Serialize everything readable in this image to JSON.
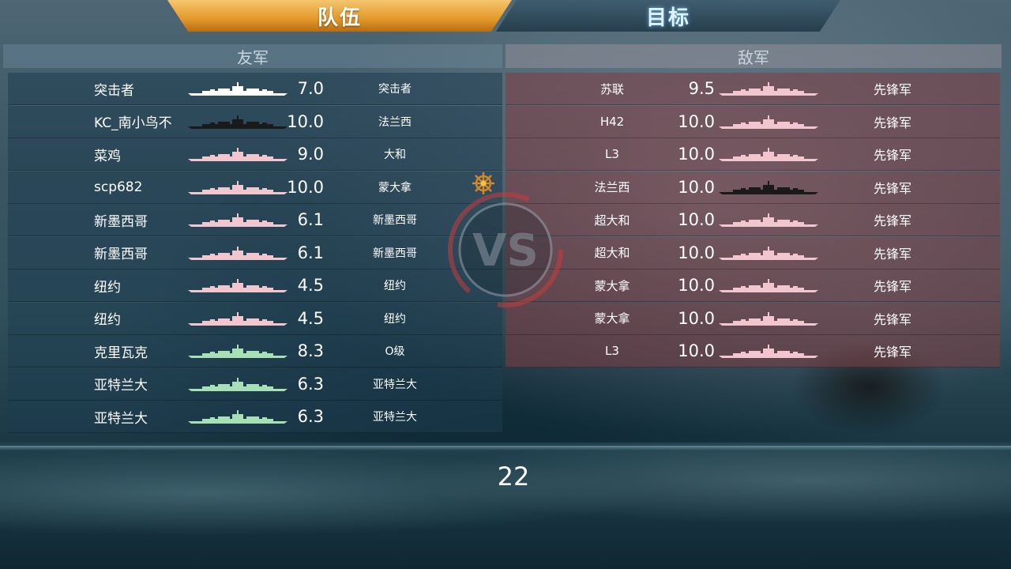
{
  "tabs": {
    "team": "队伍",
    "target": "目标"
  },
  "allies": {
    "header": "友军",
    "rows": [
      {
        "name": "突击者",
        "level": "7.0",
        "ship_class": "突击者",
        "ship_color": "#ffffff"
      },
      {
        "name": "KC_南小鸟不",
        "level": "10.0",
        "ship_class": "法兰西",
        "ship_color": "#1a1a1a"
      },
      {
        "name": "菜鸡",
        "level": "9.0",
        "ship_class": "大和",
        "ship_color": "#f2c6cf"
      },
      {
        "name": "scp682",
        "level": "10.0",
        "ship_class": "蒙大拿",
        "ship_color": "#f2c6cf"
      },
      {
        "name": "新墨西哥",
        "level": "6.1",
        "ship_class": "新墨西哥",
        "ship_color": "#f2c6cf"
      },
      {
        "name": "新墨西哥",
        "level": "6.1",
        "ship_class": "新墨西哥",
        "ship_color": "#f2c6cf"
      },
      {
        "name": "纽约",
        "level": "4.5",
        "ship_class": "纽约",
        "ship_color": "#f2c6cf"
      },
      {
        "name": "纽约",
        "level": "4.5",
        "ship_class": "纽约",
        "ship_color": "#f2c6cf"
      },
      {
        "name": "克里瓦克",
        "level": "8.3",
        "ship_class": "O级",
        "ship_color": "#a6e0b4"
      },
      {
        "name": "亚特兰大",
        "level": "6.3",
        "ship_class": "亚特兰大",
        "ship_color": "#a6e0b4"
      },
      {
        "name": "亚特兰大",
        "level": "6.3",
        "ship_class": "亚特兰大",
        "ship_color": "#a6e0b4"
      }
    ]
  },
  "enemies": {
    "header": "敌军",
    "rows": [
      {
        "name": "苏联",
        "level": "9.5",
        "ship_class": "先锋军",
        "ship_color": "#f2c6cf"
      },
      {
        "name": "H42",
        "level": "10.0",
        "ship_class": "先锋军",
        "ship_color": "#f2c6cf"
      },
      {
        "name": "L3",
        "level": "10.0",
        "ship_class": "先锋军",
        "ship_color": "#f2c6cf"
      },
      {
        "name": "法兰西",
        "level": "10.0",
        "ship_class": "先锋军",
        "ship_color": "#1a1a1a"
      },
      {
        "name": "超大和",
        "level": "10.0",
        "ship_class": "先锋军",
        "ship_color": "#f2c6cf"
      },
      {
        "name": "超大和",
        "level": "10.0",
        "ship_class": "先锋军",
        "ship_color": "#f2c6cf"
      },
      {
        "name": "蒙大拿",
        "level": "10.0",
        "ship_class": "先锋军",
        "ship_color": "#f2c6cf"
      },
      {
        "name": "蒙大拿",
        "level": "10.0",
        "ship_class": "先锋军",
        "ship_color": "#f2c6cf"
      },
      {
        "name": "L3",
        "level": "10.0",
        "ship_class": "先锋军",
        "ship_color": "#f2c6cf"
      }
    ]
  },
  "vs_label": "VS",
  "timer": "22",
  "icons": {
    "helm": "ship-wheel-icon"
  }
}
